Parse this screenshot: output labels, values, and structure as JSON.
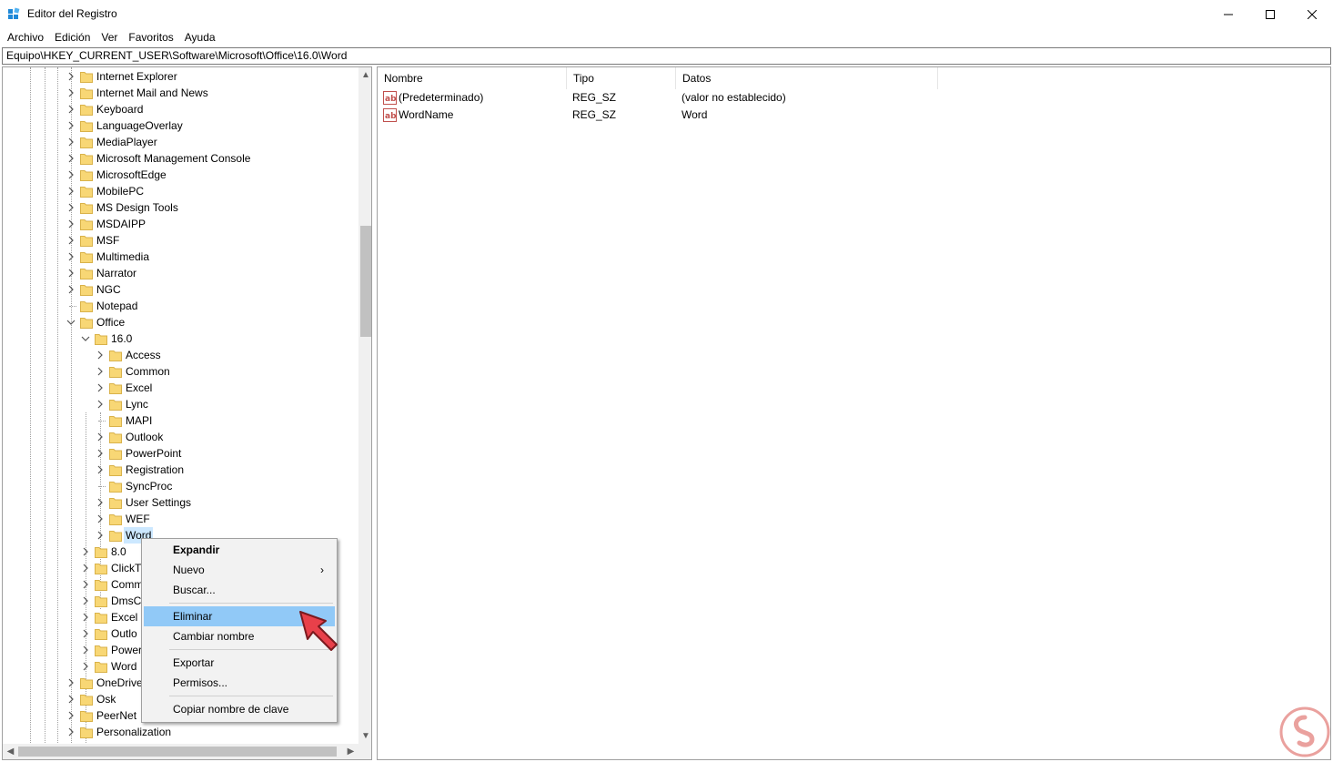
{
  "window": {
    "title": "Editor del Registro",
    "minimize_glyph": "—",
    "maximize_glyph": "☐",
    "close_glyph": "✕"
  },
  "menubar": {
    "items": [
      "Archivo",
      "Edición",
      "Ver",
      "Favoritos",
      "Ayuda"
    ]
  },
  "address": {
    "path": "Equipo\\HKEY_CURRENT_USER\\Software\\Microsoft\\Office\\16.0\\Word"
  },
  "tree": {
    "rows": [
      {
        "label": "Internet Explorer",
        "expander": "collapsed",
        "level": 0
      },
      {
        "label": "Internet Mail and News",
        "expander": "collapsed",
        "level": 0
      },
      {
        "label": "Keyboard",
        "expander": "collapsed",
        "level": 0
      },
      {
        "label": "LanguageOverlay",
        "expander": "collapsed",
        "level": 0
      },
      {
        "label": "MediaPlayer",
        "expander": "collapsed",
        "level": 0
      },
      {
        "label": "Microsoft Management Console",
        "expander": "collapsed",
        "level": 0
      },
      {
        "label": "MicrosoftEdge",
        "expander": "collapsed",
        "level": 0
      },
      {
        "label": "MobilePC",
        "expander": "collapsed",
        "level": 0
      },
      {
        "label": "MS Design Tools",
        "expander": "collapsed",
        "level": 0
      },
      {
        "label": "MSDAIPP",
        "expander": "collapsed",
        "level": 0
      },
      {
        "label": "MSF",
        "expander": "collapsed",
        "level": 0
      },
      {
        "label": "Multimedia",
        "expander": "collapsed",
        "level": 0
      },
      {
        "label": "Narrator",
        "expander": "collapsed",
        "level": 0
      },
      {
        "label": "NGC",
        "expander": "collapsed",
        "level": 0
      },
      {
        "label": "Notepad",
        "expander": "none",
        "level": 0
      },
      {
        "label": "Office",
        "expander": "expanded",
        "level": 0
      },
      {
        "label": "16.0",
        "expander": "expanded",
        "level": 1
      },
      {
        "label": "Access",
        "expander": "collapsed",
        "level": 2
      },
      {
        "label": "Common",
        "expander": "collapsed",
        "level": 2
      },
      {
        "label": "Excel",
        "expander": "collapsed",
        "level": 2
      },
      {
        "label": "Lync",
        "expander": "collapsed",
        "level": 2
      },
      {
        "label": "MAPI",
        "expander": "none",
        "level": 2
      },
      {
        "label": "Outlook",
        "expander": "collapsed",
        "level": 2
      },
      {
        "label": "PowerPoint",
        "expander": "collapsed",
        "level": 2
      },
      {
        "label": "Registration",
        "expander": "collapsed",
        "level": 2
      },
      {
        "label": "SyncProc",
        "expander": "none",
        "level": 2
      },
      {
        "label": "User Settings",
        "expander": "collapsed",
        "level": 2
      },
      {
        "label": "WEF",
        "expander": "collapsed",
        "level": 2
      },
      {
        "label": "Word",
        "expander": "collapsed",
        "level": 2,
        "selected": true
      },
      {
        "label": "8.0",
        "expander": "collapsed",
        "level": 1
      },
      {
        "label": "ClickT",
        "expander": "collapsed",
        "level": 1
      },
      {
        "label": "Comm",
        "expander": "collapsed",
        "level": 1
      },
      {
        "label": "DmsC",
        "expander": "collapsed",
        "level": 1
      },
      {
        "label": "Excel",
        "expander": "collapsed",
        "level": 1
      },
      {
        "label": "Outlo",
        "expander": "collapsed",
        "level": 1
      },
      {
        "label": "Power",
        "expander": "collapsed",
        "level": 1
      },
      {
        "label": "Word",
        "expander": "collapsed",
        "level": 1
      },
      {
        "label": "OneDrive",
        "expander": "collapsed",
        "level": 0
      },
      {
        "label": "Osk",
        "expander": "collapsed",
        "level": 0
      },
      {
        "label": "PeerNet",
        "expander": "collapsed",
        "level": 0
      },
      {
        "label": "Personalization",
        "expander": "collapsed",
        "level": 0
      }
    ]
  },
  "values": {
    "columns": [
      "Nombre",
      "Tipo",
      "Datos"
    ],
    "rows": [
      {
        "name": "(Predeterminado)",
        "type": "REG_SZ",
        "data": "(valor no establecido)",
        "icon": "ab-string-icon"
      },
      {
        "name": "WordName",
        "type": "REG_SZ",
        "data": "Word",
        "icon": "ab-string-icon"
      }
    ]
  },
  "context_menu": {
    "items": [
      {
        "label": "Expandir",
        "bold": true
      },
      {
        "label": "Nuevo",
        "submenu": true
      },
      {
        "label": "Buscar..."
      },
      {
        "separator": true
      },
      {
        "label": "Eliminar",
        "highlighted": true
      },
      {
        "label": "Cambiar nombre"
      },
      {
        "separator": true
      },
      {
        "label": "Exportar"
      },
      {
        "label": "Permisos..."
      },
      {
        "separator": true
      },
      {
        "label": "Copiar nombre de clave"
      }
    ],
    "submenu_glyph": "›"
  },
  "colors": {
    "highlight": "#91c9f7",
    "selection": "#cce8ff",
    "folder": "#f8d775",
    "pointer": "#e8404a",
    "watermark": "#d9534f"
  }
}
